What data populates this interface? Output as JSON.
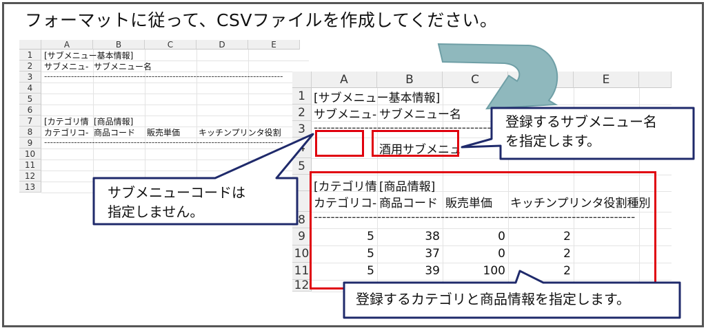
{
  "title": "フォーマットに従って、CSVファイルを作成してください。",
  "columns": [
    "A",
    "B",
    "C",
    "D",
    "E"
  ],
  "small_sheet": {
    "row_numbers": [
      "1",
      "2",
      "3",
      "4",
      "5",
      "6",
      "7",
      "8",
      "9",
      "10",
      "11",
      "12",
      "13"
    ],
    "row1_a": "[サブメニュー基本情報]",
    "row2_a": "サブメニュ-",
    "row2_b": "サブメニュー名",
    "row3_a": "--------------------------------------------------------------------------------",
    "row6_a": "[カテゴリ情",
    "row6_b": "[商品情報]",
    "row7_a": "カテゴリコ-",
    "row7_b": "商品コード",
    "row7_c": "販売単価",
    "row7_d": "キッチンプリンタ役割",
    "row8_a": "--------------------------------------------------------------------------------"
  },
  "big_sheet": {
    "row_numbers": [
      "1",
      "2",
      "3",
      "4",
      "5",
      "",
      "",
      "8",
      "9",
      "10",
      "11",
      "12"
    ],
    "row1_a": "[サブメニュー基本情報]",
    "row2_a": "サブメニュ-",
    "row2_b": "サブメニュー名",
    "row3_a": "----------------------------------------------------------------",
    "row4_b": "酒用サブメニュ",
    "row6_a": "[カテゴリ情",
    "row6_b": "[商品情報]",
    "row7_a": "カテゴリコ-",
    "row7_b": "商品コード",
    "row7_c": "販売単価",
    "row7_d": "キッチンプリンタ役割種別",
    "row8_a": "----------------------------------------------------------------------------",
    "data_rows": [
      {
        "row": "9",
        "a": "5",
        "b": "38",
        "c": "0",
        "d": "2"
      },
      {
        "row": "10",
        "a": "5",
        "b": "37",
        "c": "0",
        "d": "2"
      },
      {
        "row": "11",
        "a": "5",
        "b": "39",
        "c": "100",
        "d": "2"
      }
    ]
  },
  "callouts": {
    "submenu_name": [
      "登録するサブメニュー名",
      "を指定します。"
    ],
    "submenu_code": [
      "サブメニューコードは",
      "指定しません。"
    ],
    "category_products": "登録するカテゴリと商品情報を指定します。"
  },
  "colors": {
    "callout_border": "#1f2a6b",
    "highlight_red": "#e0000d",
    "arrow_teal": "#8fb8bd",
    "frame": "#555555"
  }
}
